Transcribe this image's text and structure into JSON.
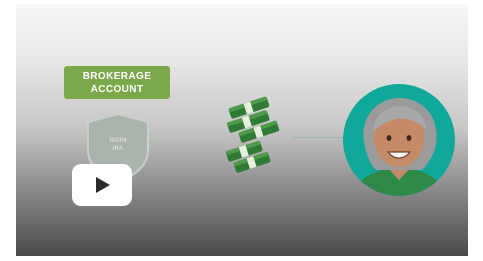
{
  "video": {
    "account_badge": {
      "line1": "BROKERAGE",
      "line2": "ACCOUNT"
    },
    "shield": {
      "line1": "ROTH",
      "line2": "IRA"
    },
    "colors": {
      "badge_green": "#7aa84a",
      "money_green": "#2f7a34",
      "avatar_teal": "#11a89c",
      "play_button": "#ffffff"
    },
    "icons": [
      "shield-icon",
      "money-stack-icon",
      "person-avatar-icon",
      "play-icon"
    ]
  }
}
